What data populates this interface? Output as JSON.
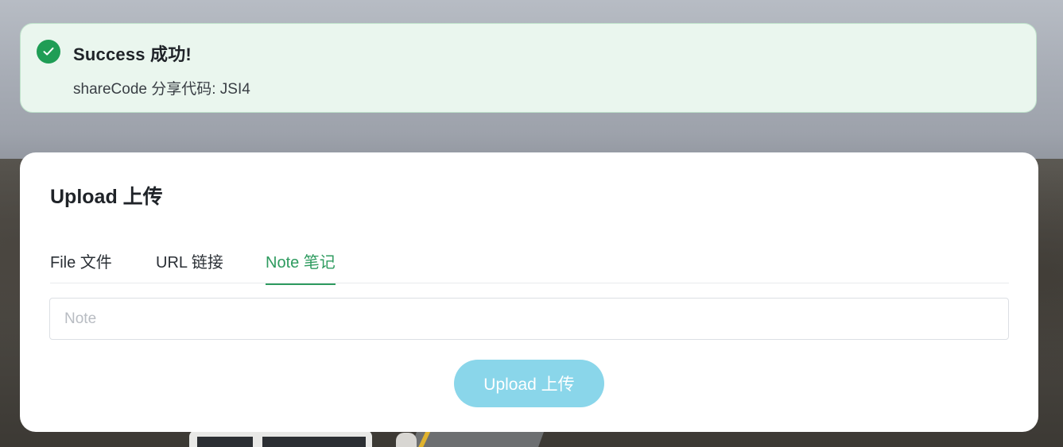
{
  "alert": {
    "icon": "check-circle-icon",
    "title": "Success 成功!",
    "description": "shareCode 分享代码: JSI4",
    "accent_color": "#1f9d55"
  },
  "upload": {
    "title": "Upload 上传",
    "tabs": [
      {
        "label": "File 文件",
        "active": false
      },
      {
        "label": "URL 链接",
        "active": false
      },
      {
        "label": "Note 笔记",
        "active": true
      }
    ],
    "note_input": {
      "value": "",
      "placeholder": "Note"
    },
    "submit_label": "Upload 上传",
    "accent_color": "#2e9b5f",
    "button_color": "#8ad6ea"
  }
}
